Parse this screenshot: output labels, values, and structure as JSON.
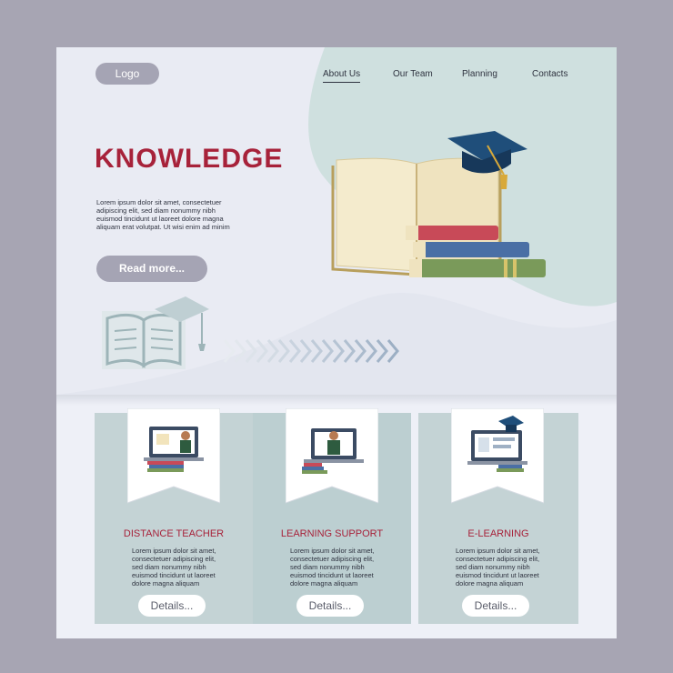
{
  "header": {
    "logo_label": "Logo",
    "nav": [
      {
        "label": "About Us",
        "active": true
      },
      {
        "label": "Our Team",
        "active": false
      },
      {
        "label": "Planning",
        "active": false
      },
      {
        "label": "Contacts",
        "active": false
      }
    ]
  },
  "hero": {
    "title": "KNOWLEDGE",
    "text": "Lorem ipsum dolor sit amet, consectetuer adipiscing elit, sed diam nonummy nibh euismod tincidunt ut laoreet dolore magna aliquam erat volutpat. Ut wisi enim ad minim",
    "cta_label": "Read more..."
  },
  "cards": [
    {
      "title": "DISTANCE TEACHER",
      "text": "Lorem ipsum dolor sit amet, consectetuer adipiscing elit, sed diam nonummy nibh euismod tincidunt ut laoreet dolore magna aliquam",
      "button_label": "Details...",
      "icon": "laptop-teacher-icon"
    },
    {
      "title": "LEARNING SUPPORT",
      "text": "Lorem ipsum dolor sit amet, consectetuer adipiscing elit, sed diam nonummy nibh euismod tincidunt ut laoreet dolore magna aliquam",
      "button_label": "Details...",
      "icon": "laptop-support-icon"
    },
    {
      "title": "E-LEARNING",
      "text": "Lorem ipsum dolor sit amet, consectetuer adipiscing elit, sed diam nonummy nibh euismod tincidunt ut laoreet dolore magna aliquam",
      "button_label": "Details...",
      "icon": "laptop-elearning-icon"
    }
  ],
  "colors": {
    "accent": "#a7223a",
    "button_gray": "#a5a4b4",
    "card_bg": "#c4d3d5",
    "page_bg": "#a7a5b3"
  }
}
